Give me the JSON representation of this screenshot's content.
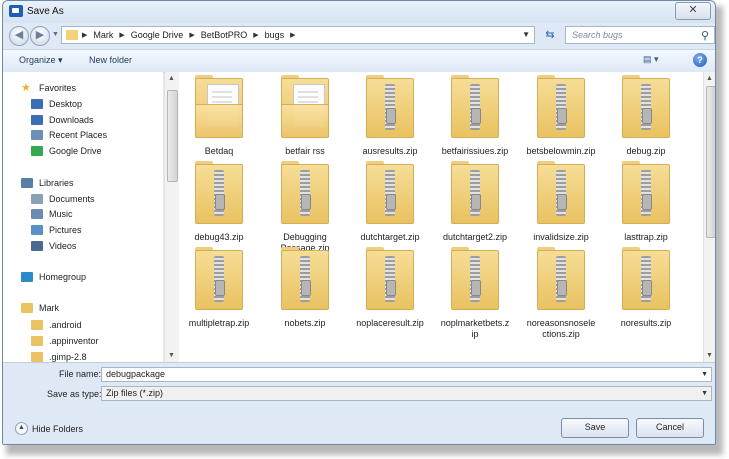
{
  "window": {
    "title": "Save As",
    "close_label": "✕"
  },
  "address": {
    "crumbs": [
      "Mark",
      "Google Drive",
      "BetBotPRO",
      "bugs"
    ]
  },
  "search": {
    "placeholder": "Search bugs"
  },
  "toolbar": {
    "organize_label": "Organize ▾",
    "new_folder_label": "New folder",
    "help_label": "?"
  },
  "sidebar": {
    "items": [
      {
        "label": "Favorites",
        "icon": "star-icon",
        "color": "#e8b23a"
      },
      {
        "label": "Desktop",
        "icon": "desktop-icon",
        "color": "#3a6fb5"
      },
      {
        "label": "Downloads",
        "icon": "downloads-icon",
        "color": "#3a6fb5"
      },
      {
        "label": "Recent Places",
        "icon": "recent-places-icon",
        "color": "#6c8fb8"
      },
      {
        "label": "Google Drive",
        "icon": "google-drive-icon",
        "color": "#34a853"
      },
      {
        "label": "Libraries",
        "icon": "libraries-icon",
        "color": "#5a7ea8"
      },
      {
        "label": "Documents",
        "icon": "documents-icon",
        "color": "#8aa0b8"
      },
      {
        "label": "Music",
        "icon": "music-icon",
        "color": "#6b8bb0"
      },
      {
        "label": "Pictures",
        "icon": "pictures-icon",
        "color": "#5a90c8"
      },
      {
        "label": "Videos",
        "icon": "videos-icon",
        "color": "#4a6a90"
      },
      {
        "label": "Homegroup",
        "icon": "homegroup-icon",
        "color": "#2a8acb"
      },
      {
        "label": "Mark",
        "icon": "user-folder-icon",
        "color": "#e9c261"
      },
      {
        "label": ".android",
        "icon": "folder-icon",
        "color": "#e9c261"
      },
      {
        "label": ".appinventor",
        "icon": "folder-icon",
        "color": "#e9c261"
      },
      {
        "label": ".gimp-2.8",
        "icon": "folder-icon",
        "color": "#e9c261"
      }
    ]
  },
  "files": [
    {
      "name": "Betdaq",
      "kind": "folder"
    },
    {
      "name": "betfair rss",
      "kind": "folder"
    },
    {
      "name": "ausresults.zip",
      "kind": "zip"
    },
    {
      "name": "betfairissiues.zip",
      "kind": "zip"
    },
    {
      "name": "betsbelowmin.zip",
      "kind": "zip"
    },
    {
      "name": "debug.zip",
      "kind": "zip"
    },
    {
      "name": "debug43.zip",
      "kind": "zip"
    },
    {
      "name": "Debugging\nPassage.zip",
      "kind": "zip"
    },
    {
      "name": "dutchtarget.zip",
      "kind": "zip"
    },
    {
      "name": "dutchtarget2.zip",
      "kind": "zip"
    },
    {
      "name": "invalidsize.zip",
      "kind": "zip"
    },
    {
      "name": "lasttrap.zip",
      "kind": "zip"
    },
    {
      "name": "multipletrap.zip",
      "kind": "zip"
    },
    {
      "name": "nobets.zip",
      "kind": "zip"
    },
    {
      "name": "noplaceresult.zip",
      "kind": "zip"
    },
    {
      "name": "noplmarketbets.z\nip",
      "kind": "zip"
    },
    {
      "name": "noreasonsnosele\nctions.zip",
      "kind": "zip"
    },
    {
      "name": "noresults.zip",
      "kind": "zip"
    }
  ],
  "form": {
    "filename_label": "File name:",
    "filename_value": "debugpackage",
    "type_label": "Save as type:",
    "type_value": "Zip files (*.zip)",
    "hide_folders_label": "Hide Folders",
    "save_label": "Save",
    "cancel_label": "Cancel"
  }
}
